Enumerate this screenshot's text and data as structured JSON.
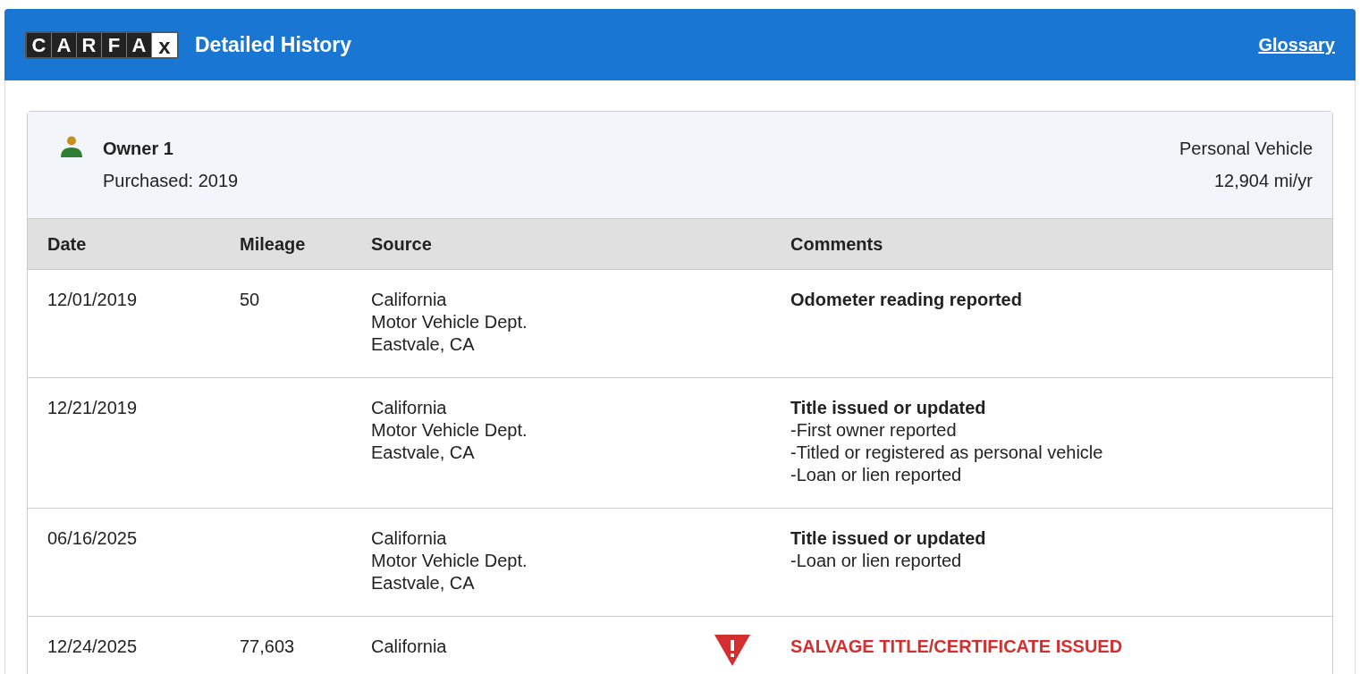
{
  "header": {
    "logo": [
      "C",
      "A",
      "R",
      "F",
      "A",
      "x"
    ],
    "title": "Detailed History",
    "link": "Glossary"
  },
  "owner": {
    "name": "Owner 1",
    "purchased": "Purchased: 2019",
    "use": "Personal Vehicle",
    "rate": "12,904 mi/yr"
  },
  "table": {
    "columns": [
      "Date",
      "Mileage",
      "Source",
      "Comments"
    ],
    "rows": [
      {
        "date": "12/01/2019",
        "mileage": "50",
        "source": [
          "California",
          "Motor Vehicle Dept.",
          "Eastvale, CA"
        ],
        "kind": "normal",
        "comment_title": "Odometer reading reported",
        "comment_lines": []
      },
      {
        "date": "12/21/2019",
        "mileage": "",
        "source": [
          "California",
          "Motor Vehicle Dept.",
          "Eastvale, CA"
        ],
        "kind": "normal",
        "comment_title": "Title issued or updated",
        "comment_lines": [
          "-First owner reported",
          "-Titled or registered as personal vehicle",
          "-Loan or lien reported"
        ]
      },
      {
        "date": "06/16/2025",
        "mileage": "",
        "source": [
          "California",
          "Motor Vehicle Dept.",
          "Eastvale, CA"
        ],
        "kind": "normal",
        "comment_title": "Title issued or updated",
        "comment_lines": [
          "-Loan or lien reported"
        ]
      },
      {
        "date": "12/24/2025",
        "mileage": "77,603",
        "source": [
          "California"
        ],
        "kind": "alert",
        "comment_title": "SALVAGE TITLE/CERTIFICATE ISSUED",
        "comment_lines": []
      }
    ]
  }
}
